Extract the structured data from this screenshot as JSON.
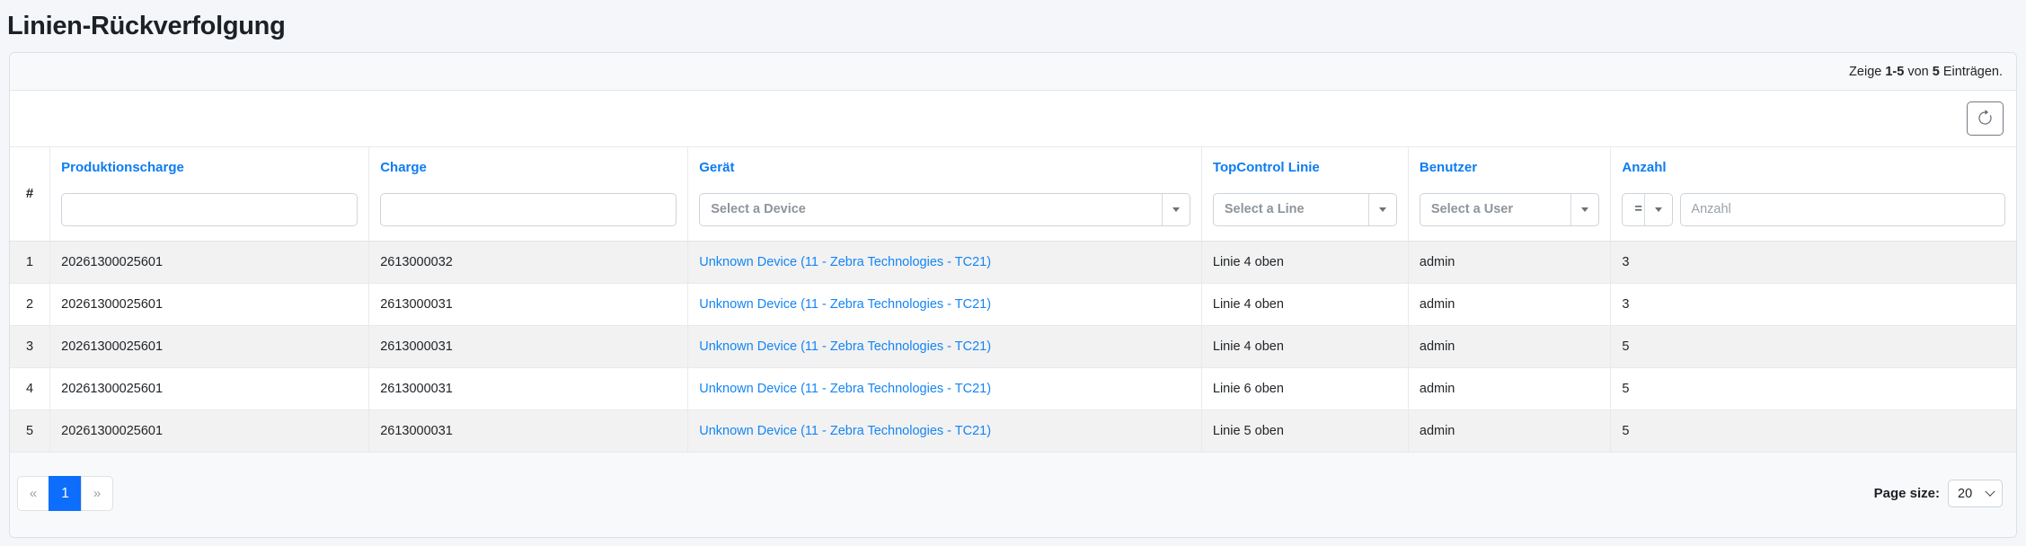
{
  "page": {
    "title": "Linien-Rückverfolgung"
  },
  "summary": {
    "show_label": "Zeige",
    "range": "1-5",
    "of_label": "von",
    "total": "5",
    "entries_label": "Einträgen."
  },
  "colors": {
    "accent_header_link": "#0d7cf2",
    "device_link": "#1485f5",
    "active_page_bg": "#0d6efd",
    "stripe_row_bg": "#f2f2f2",
    "panel_strip_bg": "#f8f9fa"
  },
  "table": {
    "columns": [
      "#",
      "Produktionscharge",
      "Charge",
      "Gerät",
      "TopControl Linie",
      "Benutzer",
      "Anzahl"
    ],
    "filters": {
      "produktionscharge": {
        "value": ""
      },
      "charge": {
        "value": ""
      },
      "geraet": {
        "placeholder": "Select a Device"
      },
      "topcontrol_linie": {
        "placeholder": "Select a Line"
      },
      "benutzer": {
        "placeholder": "Select a User"
      },
      "anzahl": {
        "operator": "=",
        "placeholder": "Anzahl"
      }
    },
    "rows": [
      {
        "num": "1",
        "produktionscharge": "20261300025601",
        "charge": "2613000032",
        "geraet": "Unknown Device (11 - Zebra Technologies - TC21)",
        "topcontrol_linie": "Linie 4 oben",
        "benutzer": "admin",
        "anzahl": "3"
      },
      {
        "num": "2",
        "produktionscharge": "20261300025601",
        "charge": "2613000031",
        "geraet": "Unknown Device (11 - Zebra Technologies - TC21)",
        "topcontrol_linie": "Linie 4 oben",
        "benutzer": "admin",
        "anzahl": "3"
      },
      {
        "num": "3",
        "produktionscharge": "20261300025601",
        "charge": "2613000031",
        "geraet": "Unknown Device (11 - Zebra Technologies - TC21)",
        "topcontrol_linie": "Linie 4 oben",
        "benutzer": "admin",
        "anzahl": "5"
      },
      {
        "num": "4",
        "produktionscharge": "20261300025601",
        "charge": "2613000031",
        "geraet": "Unknown Device (11 - Zebra Technologies - TC21)",
        "topcontrol_linie": "Linie 6 oben",
        "benutzer": "admin",
        "anzahl": "5"
      },
      {
        "num": "5",
        "produktionscharge": "20261300025601",
        "charge": "2613000031",
        "geraet": "Unknown Device (11 - Zebra Technologies - TC21)",
        "topcontrol_linie": "Linie 5 oben",
        "benutzer": "admin",
        "anzahl": "5"
      }
    ]
  },
  "pagination": {
    "first": "«",
    "current": "1",
    "last": "»"
  },
  "page_size": {
    "label": "Page size:",
    "value": "20"
  }
}
